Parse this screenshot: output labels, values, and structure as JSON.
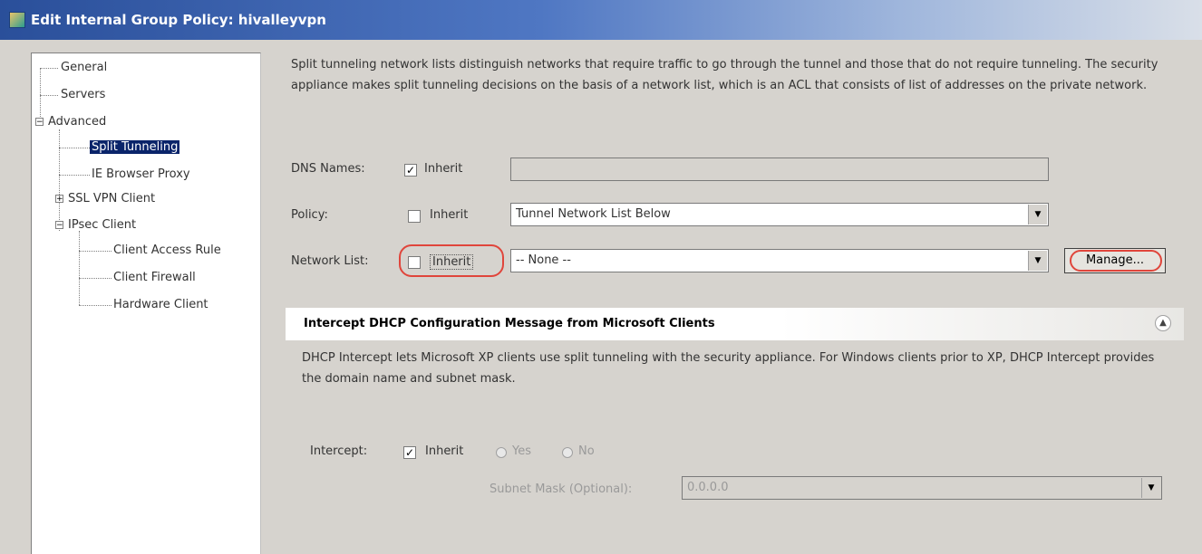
{
  "window": {
    "title": "Edit Internal Group Policy: hivalleyvpn"
  },
  "tree": {
    "general": "General",
    "servers": "Servers",
    "advanced": "Advanced",
    "split_tunneling": "Split Tunneling",
    "ie_browser_proxy": "IE Browser Proxy",
    "ssl_vpn_client": "SSL VPN Client",
    "ipsec_client": "IPsec Client",
    "client_access_rule": "Client Access Rule",
    "client_firewall": "Client Firewall",
    "hardware_client": "Hardware Client"
  },
  "description": "Split tunneling network lists distinguish networks that require traffic to go through the tunnel and those that do not require tunneling. The security appliance makes split tunneling decisions on the basis of a network list, which is an ACL that consists of list of addresses on the private network.",
  "form": {
    "dns_label": "DNS Names:",
    "dns_inherit": "Inherit",
    "dns_inherit_checked": true,
    "dns_value": "",
    "policy_label": "Policy:",
    "policy_inherit": "Inherit",
    "policy_inherit_checked": false,
    "policy_value": "Tunnel Network List Below",
    "network_label": "Network List:",
    "network_inherit": "Inherit",
    "network_inherit_checked": false,
    "network_value": "-- None --",
    "manage_label": "Manage..."
  },
  "dhcp": {
    "title": "Intercept DHCP Configuration Message from Microsoft Clients",
    "description": "DHCP Intercept lets Microsoft XP clients use split tunneling with the security appliance. For Windows clients prior to XP, DHCP Intercept provides the domain name and subnet mask.",
    "intercept_label": "Intercept:",
    "inherit_label": "Inherit",
    "inherit_checked": true,
    "yes_label": "Yes",
    "no_label": "No",
    "subnet_label": "Subnet Mask (Optional):",
    "subnet_value": "0.0.0.0"
  },
  "colors": {
    "highlight_oval": "#e0453b",
    "selection": "#0a246a"
  },
  "icons": [
    "app-icon",
    "expander-icon",
    "collapse-icon",
    "dropdown-arrow-icon",
    "checkbox-icon",
    "radio-icon"
  ]
}
